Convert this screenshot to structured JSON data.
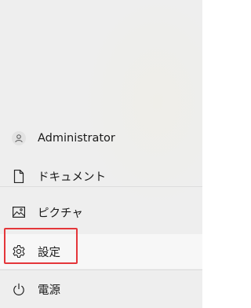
{
  "start_menu": {
    "items": [
      {
        "label": "Administrator",
        "icon": "user-avatar-icon"
      },
      {
        "label": "ドキュメント",
        "icon": "document-icon"
      },
      {
        "label": "ピクチャ",
        "icon": "picture-icon"
      },
      {
        "label": "設定",
        "icon": "gear-icon",
        "highlighted": true
      },
      {
        "label": "電源",
        "icon": "power-icon"
      }
    ],
    "highlight_color": "#e4363a"
  }
}
